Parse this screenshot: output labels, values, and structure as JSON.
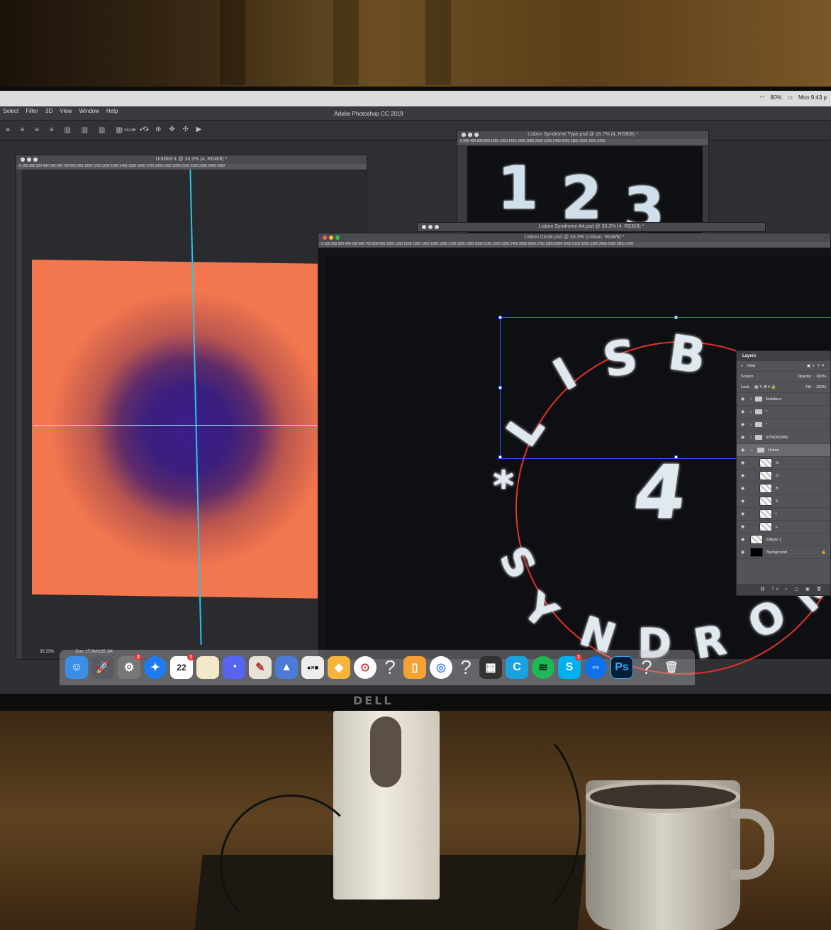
{
  "menubar": {
    "menus": [
      "Select",
      "Filter",
      "3D",
      "View",
      "Window",
      "Help"
    ],
    "app_title": "Adobe Photoshop CC 2019",
    "battery": "80%",
    "clock": "Mon 9:43 p"
  },
  "optionsbar": {
    "mode_label": "3D Mode:"
  },
  "docs": {
    "untitled": {
      "title": "Untitled-1 @ 33.3% (4, RGB/8) *",
      "ruler": "0  100  200  300  400  500  600  700  800  900  1000  1100  1200  1300  1400  1500  1600  1700  1800  1900  2000  2100  2200  2300  2400  2500",
      "zoom": "33.33%",
      "doc_size": "Doc: 17.6M/135.1M"
    },
    "type": {
      "title": "Lisbon Syndrome Type.psd @ 16.7% (4, RGB/8) *",
      "ruler": "0  200  400  600  800  1000  1200  1400  1600  1800  2000  2200  2400  2600  2800  3000  3200  3400",
      "numbers": [
        "1",
        "2",
        "3"
      ]
    },
    "a4": {
      "title": "Lisbon Syndrome A4.psd @ 33.3% (4, RGB/8) *"
    },
    "circle": {
      "title": "Lisbon Circle.psd @ 33.3% (Lisbon, RGB/8) *",
      "ruler": "0  100  200  300  400  500  600  700  800  900  1000  1100  1200  1300  1400  1500  1600  1700  1800  1900  2000  2100  2200  2300  2400  2500  2600  2700  2800  2900  3000  3100  3200  3300  3400  3500  3600  3700",
      "lettering": [
        "L",
        "I",
        "S",
        "B",
        "*",
        "4",
        "S",
        "Y",
        "N",
        "D",
        "R",
        "O",
        "M"
      ]
    }
  },
  "layers_panel": {
    "tab": "Layers",
    "filter": "Kind",
    "blend_mode": "Screen",
    "opacity_label": "Opacity:",
    "opacity_value": "100%",
    "lock_label": "Lock:",
    "fill_label": "Fill:",
    "fill_value": "100%",
    "layers": [
      {
        "name": "Numbers",
        "kind": "group"
      },
      {
        "name": "*",
        "kind": "group"
      },
      {
        "name": "*",
        "kind": "group"
      },
      {
        "name": "SYNDROME",
        "kind": "group"
      },
      {
        "name": "Lisbon",
        "kind": "group",
        "selected": true
      },
      {
        "name": "N",
        "kind": "layer"
      },
      {
        "name": "O",
        "kind": "layer"
      },
      {
        "name": "B",
        "kind": "layer"
      },
      {
        "name": "S",
        "kind": "layer"
      },
      {
        "name": "I",
        "kind": "layer"
      },
      {
        "name": "L",
        "kind": "layer"
      },
      {
        "name": "Ellipse 1",
        "kind": "shape"
      },
      {
        "name": "Background",
        "kind": "background"
      }
    ]
  },
  "dock": {
    "calendar_day": "22",
    "calendar_badge": "1",
    "prefs_badge": "2",
    "skype_badge": "1",
    "ps_label": "Ps",
    "unknown_glyph": "?"
  },
  "monitor": {
    "brand": "DELL"
  },
  "colors": {
    "canvas_orange": "#f2764e",
    "spray_purple": "#3b1d8a",
    "guide_cyan": "#27c5f0",
    "selection_blue": "#2b5cff",
    "ellipse_red": "#e3322a"
  }
}
